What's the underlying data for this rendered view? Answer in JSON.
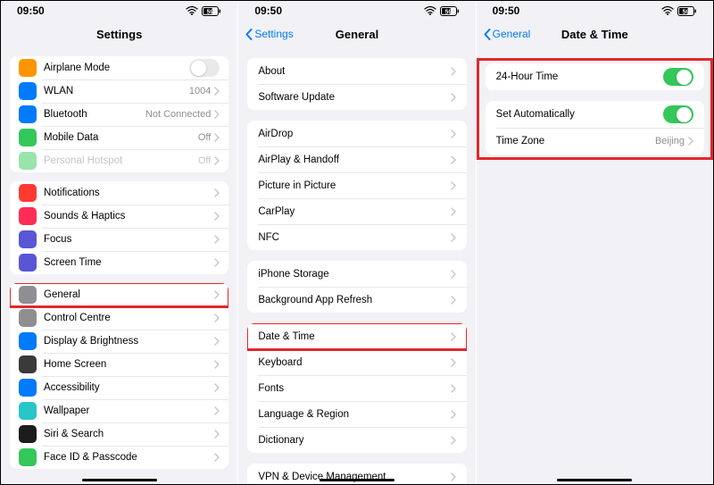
{
  "status": {
    "time": "09:50",
    "battery": "59"
  },
  "phone1": {
    "title": "Settings",
    "g1": [
      {
        "label": "Airplane Mode",
        "icon_color": "#ff9500",
        "toggle": "off"
      },
      {
        "label": "WLAN",
        "icon_color": "#007aff",
        "detail": "1004"
      },
      {
        "label": "Bluetooth",
        "icon_color": "#007aff",
        "detail": "Not Connected"
      },
      {
        "label": "Mobile Data",
        "icon_color": "#34c759",
        "detail": "Off"
      },
      {
        "label": "Personal Hotspot",
        "icon_color": "#34c759",
        "detail": "Off",
        "dimmed": true
      }
    ],
    "g2": [
      {
        "label": "Notifications",
        "icon_color": "#ff3b30"
      },
      {
        "label": "Sounds & Haptics",
        "icon_color": "#ff2d55"
      },
      {
        "label": "Focus",
        "icon_color": "#5856d6"
      },
      {
        "label": "Screen Time",
        "icon_color": "#5856d6"
      }
    ],
    "g3": [
      {
        "label": "General",
        "icon_color": "#8e8e93",
        "hl": true
      },
      {
        "label": "Control Centre",
        "icon_color": "#8e8e93"
      },
      {
        "label": "Display & Brightness",
        "icon_color": "#007aff"
      },
      {
        "label": "Home Screen",
        "icon_color": "#3a3a3c"
      },
      {
        "label": "Accessibility",
        "icon_color": "#007aff"
      },
      {
        "label": "Wallpaper",
        "icon_color": "#29c5c7"
      },
      {
        "label": "Siri & Search",
        "icon_color": "#1c1c1e"
      },
      {
        "label": "Face ID & Passcode",
        "icon_color": "#34c759"
      }
    ]
  },
  "phone2": {
    "back": "Settings",
    "title": "General",
    "g1": [
      {
        "label": "About"
      },
      {
        "label": "Software Update"
      }
    ],
    "g2": [
      {
        "label": "AirDrop"
      },
      {
        "label": "AirPlay & Handoff"
      },
      {
        "label": "Picture in Picture"
      },
      {
        "label": "CarPlay"
      },
      {
        "label": "NFC"
      }
    ],
    "g3": [
      {
        "label": "iPhone Storage"
      },
      {
        "label": "Background App Refresh"
      }
    ],
    "g4": [
      {
        "label": "Date & Time",
        "hl": true
      },
      {
        "label": "Keyboard"
      },
      {
        "label": "Fonts"
      },
      {
        "label": "Language & Region"
      },
      {
        "label": "Dictionary"
      }
    ],
    "g5": [
      {
        "label": "VPN & Device Management"
      }
    ]
  },
  "phone3": {
    "back": "General",
    "title": "Date & Time",
    "g1": [
      {
        "label": "24-Hour Time",
        "toggle": "on"
      }
    ],
    "g2": [
      {
        "label": "Set Automatically",
        "toggle": "on"
      },
      {
        "label": "Time Zone",
        "detail": "Beijing"
      }
    ]
  }
}
